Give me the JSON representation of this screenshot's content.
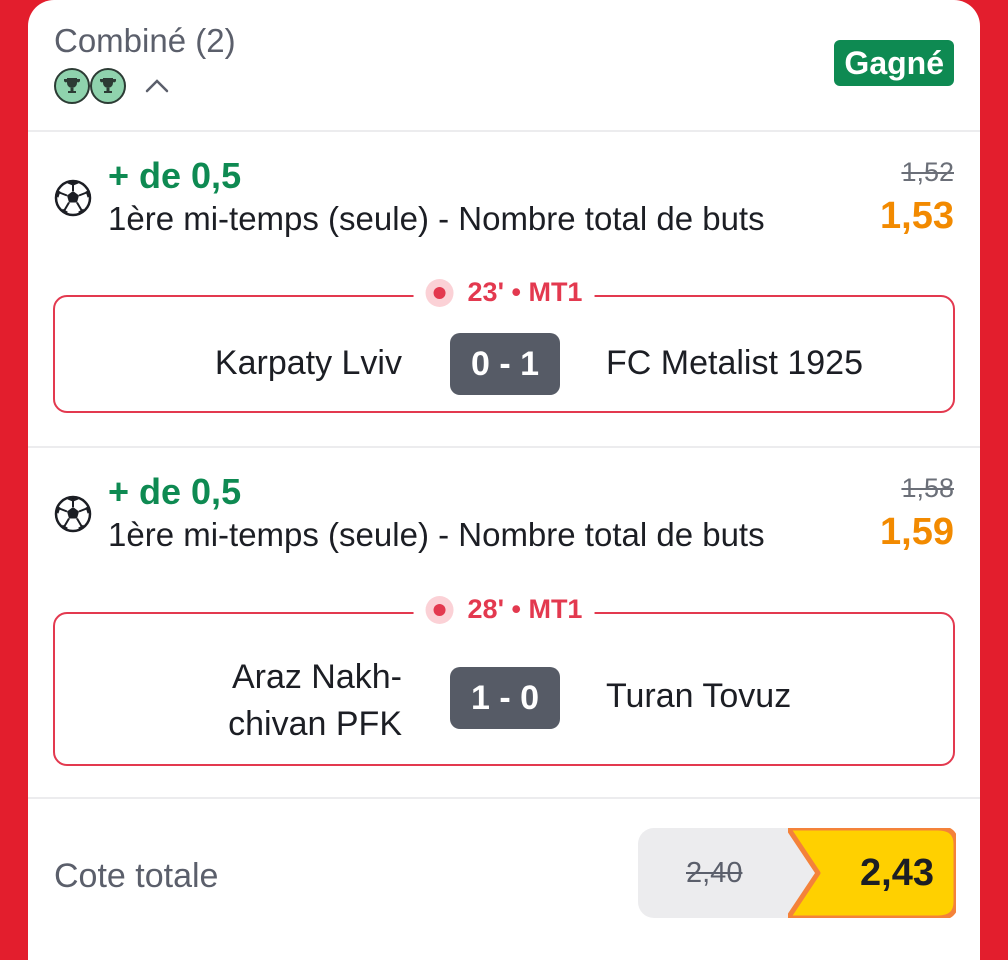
{
  "header": {
    "title": "Combiné (2)",
    "status": "Gagné",
    "trophy_icons": [
      "trophy-icon",
      "trophy-icon"
    ],
    "toggle_icon": "chevron-up-icon"
  },
  "bets": [
    {
      "selection": "+ de 0,5",
      "market": "1ère mi-temps (seule) - Nombre total de buts",
      "odd_old": "1,52",
      "odd_new": "1,53",
      "live": "23' • MT1",
      "home": "Karpaty Lviv",
      "score": "0 - 1",
      "away": "FC Metalist 1925"
    },
    {
      "selection": "+ de 0,5",
      "market": "1ère mi-temps (seule) - Nombre total de buts",
      "odd_old": "1,58",
      "odd_new": "1,59",
      "live": "28' • MT1",
      "home_line1": "Araz Nakh-",
      "home_line2": "chivan PFK",
      "score": "1 - 0",
      "away": "Turan Tovuz"
    }
  ],
  "total": {
    "label": "Cote totale",
    "old": "2,40",
    "new": "2,43"
  },
  "colors": {
    "background": "#e31e2d",
    "won_green": "#0e8a52",
    "odd_orange": "#f28a00",
    "live_red": "#e3394f",
    "boost_yellow": "#ffd000"
  }
}
